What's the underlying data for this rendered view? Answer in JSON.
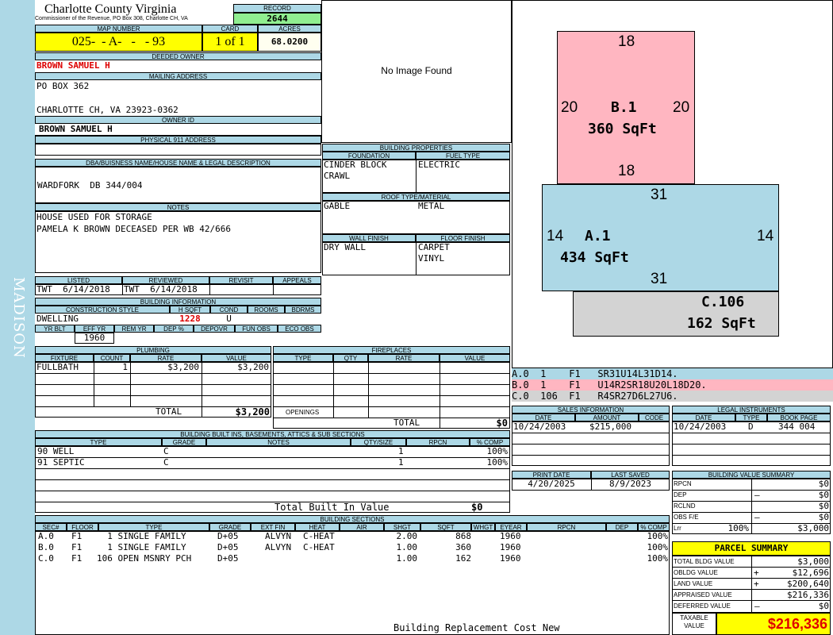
{
  "county": "Charlotte County Virginia",
  "commissioner": "Commissioner of the Revenue, PO Box 308, Charlotte CH, VA",
  "side_label": "MADISON",
  "record": {
    "label": "RECORD",
    "value": "2644"
  },
  "map": {
    "label": "MAP NUMBER",
    "value": "025-  - A-   -   - 93"
  },
  "card": {
    "label": "CARD",
    "value": "1 of 1"
  },
  "acres": {
    "label": "ACRES",
    "value": "68.0200"
  },
  "owner": {
    "label": "DEEDED OWNER",
    "value": "BROWN SAMUEL H"
  },
  "mailing": {
    "label": "MAILING ADDRESS",
    "line1": "PO BOX 362",
    "line2": "CHARLOTTE CH, VA 23923-0362"
  },
  "owner_id": {
    "label": "OWNER ID",
    "value": "BROWN SAMUEL H"
  },
  "physical": {
    "label": "PHYSICAL 911 ADDRESS",
    "value": ""
  },
  "dba": {
    "label": "DBA/BUISNESS NAME/HOUSE NAME & LEGAL DESCRIPTION",
    "value": "WARDFORK  DB 344/004"
  },
  "notes": {
    "label": "NOTES",
    "line1": "HOUSE USED FOR STORAGE",
    "line2": "PAMELA K BROWN DECEASED PER WB 42/666"
  },
  "status": {
    "listed_label": "LISTED",
    "reviewed_label": "REVIEWED",
    "revisit_label": "REVISIT",
    "appeals_label": "APPEALS",
    "listed": "TWT  6/14/2018",
    "reviewed": "TWT  6/14/2018"
  },
  "bldg_info": {
    "label": "BUILDING INFORMATION",
    "cs_label": "CONSTRUCTION STYLE",
    "hsqft_label": "H SQFT",
    "cond_label": "COND",
    "rooms_label": "ROOMS",
    "bdrms_label": "BDRMS",
    "style": "DWELLING",
    "hsqft": "1228",
    "cond": "U",
    "yrblt_label": "YR BLT",
    "effyr_label": "EFF YR",
    "remyr_label": "REM YR",
    "dep_label": "DEP %",
    "depovr_label": "DEPOVR",
    "funobs_label": "FUN OBS",
    "ecoobs_label": "ECO OBS",
    "effyr": "1960"
  },
  "no_image": "No Image Found",
  "bldg_props": {
    "label": "BUILDING PROPERTIES",
    "foundation_label": "FOUNDATION",
    "fuel_label": "FUEL TYPE",
    "foundation1": "CINDER BLOCK",
    "foundation2": "CRAWL",
    "fuel": "ELECTRIC",
    "roof_label": "ROOF TYPE/MATERIAL",
    "roof_type": "GABLE",
    "roof_mat": "METAL",
    "wall_label": "WALL FINISH",
    "floor_label": "FLOOR FINISH",
    "wall": "DRY WALL",
    "floor1": "CARPET",
    "floor2": "VINYL"
  },
  "plumbing": {
    "label": "PLUMBING",
    "cols": [
      "FIXTURE",
      "COUNT",
      "RATE",
      "VALUE"
    ],
    "fixture": "FULLBATH",
    "count": "1",
    "rate": "$3,200",
    "value": "$3,200",
    "total_label": "TOTAL",
    "total": "$3,200"
  },
  "fireplaces": {
    "label": "FIREPLACES",
    "cols": [
      "TYPE",
      "QTY",
      "RATE",
      "VALUE"
    ],
    "openings": "OPENINGS",
    "total_label": "TOTAL",
    "total": "$0"
  },
  "builtins": {
    "label": "BUILDING BUILT INS, BASEMENTS, ATTICS & SUB SECTIONS",
    "cols": [
      "TYPE",
      "GRADE",
      "NOTES",
      "QTY/SIZE",
      "RPCN",
      "% COMP"
    ],
    "rows": [
      {
        "type": "90 WELL",
        "grade": "C",
        "qty": "1",
        "comp": "100%"
      },
      {
        "type": "91 SEPTIC",
        "grade": "C",
        "qty": "1",
        "comp": "100%"
      }
    ],
    "total_label": "Total Built In Value",
    "total": "$0"
  },
  "sections": {
    "label": "BUILDING SECTIONS",
    "cols": [
      "SEC#",
      "FLOOR",
      "TYPE",
      "GRADE",
      "EXT FIN",
      "HEAT",
      "AIR",
      "SHGT",
      "SQFT",
      "WHGT",
      "EYEAR",
      "RPCN",
      "DEP",
      "% COMP"
    ],
    "rows": [
      {
        "sec": "A.0",
        "floor": "F1",
        "type": "  1 SINGLE FAMILY",
        "grade": "D+05",
        "ext": "ALVYN",
        "heat": "C-HEAT",
        "shgt": "2.00",
        "sqft": "868",
        "eyear": "1960",
        "comp": "100%"
      },
      {
        "sec": "B.0",
        "floor": "F1",
        "type": "  1 SINGLE FAMILY",
        "grade": "D+05",
        "ext": "ALVYN",
        "heat": "C-HEAT",
        "shgt": "1.00",
        "sqft": "360",
        "eyear": "1960",
        "comp": "100%"
      },
      {
        "sec": "C.0",
        "floor": "F1",
        "type": "106 OPEN MSNRY PCH",
        "grade": "D+05",
        "ext": "",
        "heat": "",
        "shgt": "1.00",
        "sqft": "162",
        "eyear": "1960",
        "comp": "100%"
      }
    ],
    "footer": "Building Replacement Cost New"
  },
  "sketch": {
    "b_top": "18",
    "b_left": "20",
    "b_right": "20",
    "b_bottom": "18",
    "b_name": "B.1",
    "b_area": "360 SqFt",
    "a_top": "31",
    "a_left": "14",
    "a_right": "14",
    "a_bottom": "31",
    "a_name": "A.1",
    "a_area": "434 SqFt",
    "c_name": "C.106",
    "c_area": "162 SqFt",
    "colors": {
      "b": "#ffb6c1",
      "a": "#add8e6",
      "c": "#d3d3d3"
    }
  },
  "vectors": [
    "A.0  1    F1   SR31U14L31D14.",
    "B.0  1    F1   U14R2SR18U20L18D20.",
    "C.0  106  F1   R4SR27D6L27U6."
  ],
  "sales": {
    "label": "SALES INFORMATION",
    "cols": [
      "DATE",
      "AMOUNT",
      "CODE"
    ],
    "date": "10/24/2003",
    "amount": "$215,000"
  },
  "legal": {
    "label": "LEGAL INSTRUMENTS",
    "cols": [
      "DATE",
      "TYPE",
      "BOOK PAGE"
    ],
    "date": "10/24/2003",
    "type": "D",
    "book": "344 004"
  },
  "print": {
    "print_label": "PRINT DATE",
    "saved_label": "LAST SAVED",
    "print_date": "4/20/2025",
    "saved_date": "8/9/2023"
  },
  "bvs": {
    "label": "BUILDING VALUE SUMMARY",
    "rows": [
      {
        "label": "RPCN",
        "sign": "",
        "value": "$0"
      },
      {
        "label": "DEP",
        "sign": "–",
        "value": "$0"
      },
      {
        "label": "RCLND",
        "sign": "",
        "value": "$0"
      },
      {
        "label": "OBS F/E",
        "sign": "–",
        "value": "$0"
      },
      {
        "label": "Lrr",
        "pct": "100%",
        "sign": "",
        "value": "$3,000"
      }
    ]
  },
  "parcel": {
    "label": "PARCEL SUMMARY",
    "rows": [
      {
        "label": "TOTAL BLDG VALUE",
        "sign": "",
        "value": "$3,000"
      },
      {
        "label": "OBLDG VALUE",
        "sign": "+",
        "value": "$12,696"
      },
      {
        "label": "LAND VALUE",
        "sign": "+",
        "value": "$200,640"
      },
      {
        "label": "APPRAISED VALUE",
        "sign": "",
        "value": "$216,336"
      },
      {
        "label": "DEFERRED VALUE",
        "sign": "–",
        "value": "$0"
      }
    ],
    "taxable_label1": "TAXABLE",
    "taxable_label2": "VALUE",
    "taxable": "$216,336"
  }
}
